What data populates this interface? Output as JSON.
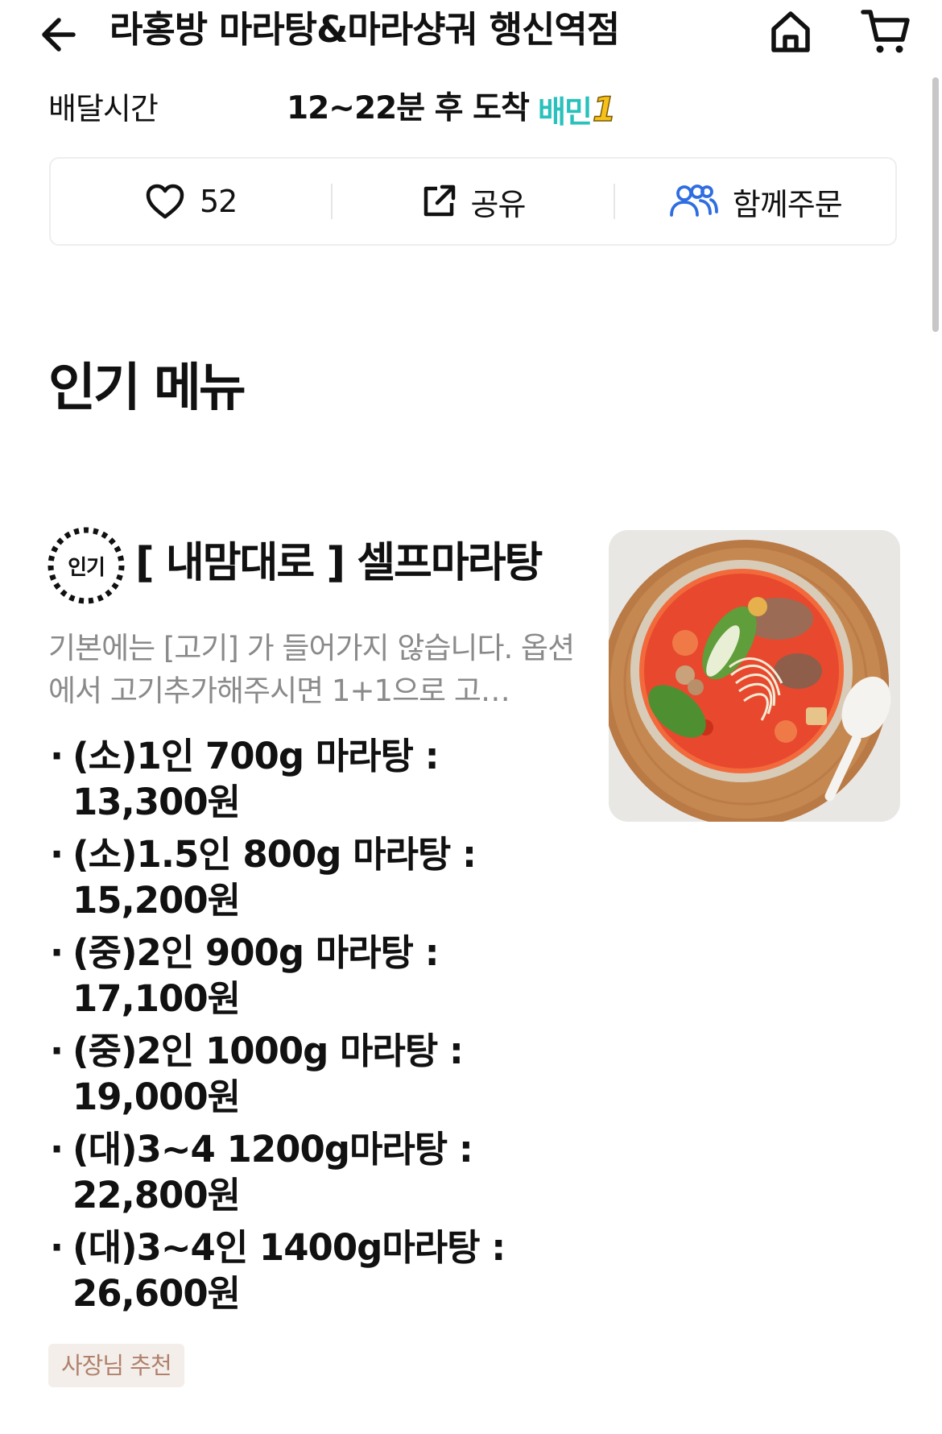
{
  "header": {
    "title": "라홍방 마라탕&마라샹궈 행신역점",
    "back_icon": "arrow-left-icon",
    "home_icon": "home-icon",
    "cart_icon": "cart-icon"
  },
  "delivery": {
    "label": "배달시간",
    "time": "12~22분 후 도착",
    "badge_text": "배민",
    "badge_number": "1",
    "badge_color": "#2ac1bc",
    "badge_number_color": "#f6c11b"
  },
  "actions": {
    "like_count": "52",
    "share_label": "공유",
    "group_order_label": "함께주문",
    "group_icon_color": "#2f6de1"
  },
  "section": {
    "title": "인기 메뉴"
  },
  "menu_item": {
    "badge": "인기",
    "name": "[ 내맘대로 ] 셀프마라탕",
    "description": "기본에는 [고기] 가 들어가지 않습니다. 옵션에서 고기추가해주시면 1+1으로 고…",
    "prices": [
      "(소)1인 700g 마라탕 : 13,300원",
      "(소)1.5인 800g 마라탕 : 15,200원",
      "(중)2인 900g 마라탕 : 17,100원",
      "(중)2인 1000g 마라탕 : 19,000원",
      "(대)3~4 1200g마라탕 : 22,800원",
      "(대)3~4인 1400g마라탕 : 26,600원"
    ],
    "tag": "사장님 추천",
    "image": "malatang-bowl-photo"
  }
}
